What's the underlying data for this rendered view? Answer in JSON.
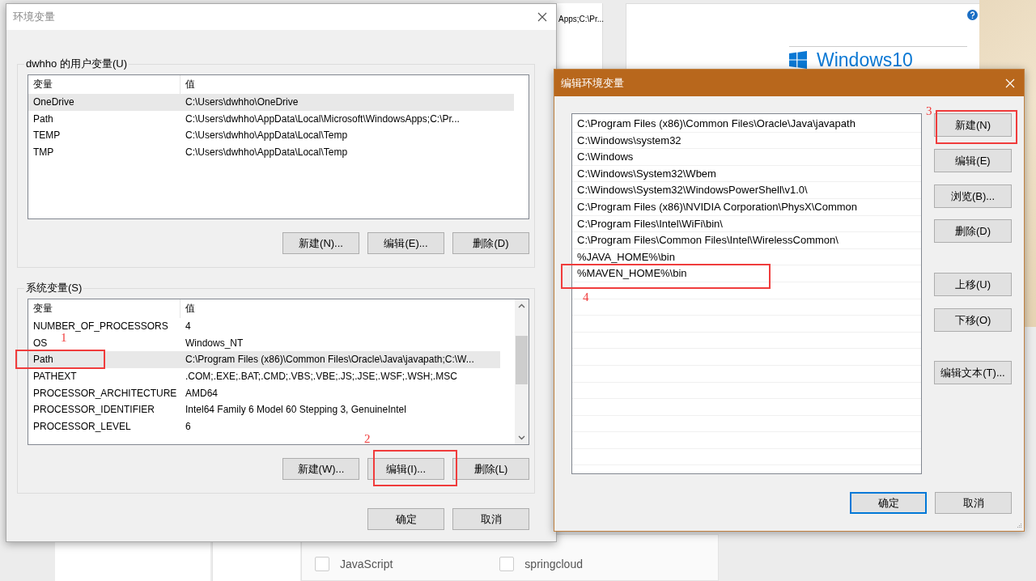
{
  "background": {
    "strip_text": "Apps;C:\\Pr...",
    "logo_text": "Windows10",
    "checkboxes": [
      {
        "label": "JavaScript",
        "checked": false
      },
      {
        "label": "springcloud",
        "checked": false
      }
    ]
  },
  "env_dialog": {
    "title": "环境变量",
    "user_group": {
      "label": "dwhho 的用户变量(U)",
      "columns": [
        "变量",
        "值"
      ],
      "rows": [
        {
          "name": "OneDrive",
          "value": "C:\\Users\\dwhho\\OneDrive",
          "selected": true
        },
        {
          "name": "Path",
          "value": "C:\\Users\\dwhho\\AppData\\Local\\Microsoft\\WindowsApps;C:\\Pr...",
          "selected": false
        },
        {
          "name": "TEMP",
          "value": "C:\\Users\\dwhho\\AppData\\Local\\Temp",
          "selected": false
        },
        {
          "name": "TMP",
          "value": "C:\\Users\\dwhho\\AppData\\Local\\Temp",
          "selected": false
        }
      ],
      "buttons": [
        "新建(N)...",
        "编辑(E)...",
        "删除(D)"
      ]
    },
    "system_group": {
      "label": "系统变量(S)",
      "columns": [
        "变量",
        "值"
      ],
      "rows": [
        {
          "name": "NUMBER_OF_PROCESSORS",
          "value": "4",
          "selected": false
        },
        {
          "name": "OS",
          "value": "Windows_NT",
          "selected": false
        },
        {
          "name": "Path",
          "value": "C:\\Program Files (x86)\\Common Files\\Oracle\\Java\\javapath;C:\\W...",
          "selected": true
        },
        {
          "name": "PATHEXT",
          "value": ".COM;.EXE;.BAT;.CMD;.VBS;.VBE;.JS;.JSE;.WSF;.WSH;.MSC",
          "selected": false
        },
        {
          "name": "PROCESSOR_ARCHITECTURE",
          "value": "AMD64",
          "selected": false
        },
        {
          "name": "PROCESSOR_IDENTIFIER",
          "value": "Intel64 Family 6 Model 60 Stepping 3, GenuineIntel",
          "selected": false
        },
        {
          "name": "PROCESSOR_LEVEL",
          "value": "6",
          "selected": false
        }
      ],
      "buttons": [
        "新建(W)...",
        "编辑(I)...",
        "删除(L)"
      ]
    },
    "buttons": [
      {
        "label": "确定",
        "default": false
      },
      {
        "label": "取消",
        "default": false
      }
    ]
  },
  "edit_dialog": {
    "title": "编辑环境变量",
    "entries": [
      {
        "text": "C:\\Program Files (x86)\\Common Files\\Oracle\\Java\\javapath",
        "selected": false
      },
      {
        "text": "C:\\Windows\\system32",
        "selected": false
      },
      {
        "text": "C:\\Windows",
        "selected": false
      },
      {
        "text": "C:\\Windows\\System32\\Wbem",
        "selected": false
      },
      {
        "text": "C:\\Windows\\System32\\WindowsPowerShell\\v1.0\\",
        "selected": false
      },
      {
        "text": "C:\\Program Files (x86)\\NVIDIA Corporation\\PhysX\\Common",
        "selected": false
      },
      {
        "text": "C:\\Program Files\\Intel\\WiFi\\bin\\",
        "selected": false
      },
      {
        "text": "C:\\Program Files\\Common Files\\Intel\\WirelessCommon\\",
        "selected": false
      },
      {
        "text": "%JAVA_HOME%\\bin",
        "selected": false
      },
      {
        "text": "%MAVEN_HOME%\\bin",
        "selected": false
      }
    ],
    "side_buttons": [
      "新建(N)",
      "编辑(E)",
      "浏览(B)...",
      "删除(D)",
      "上移(U)",
      "下移(O)",
      "编辑文本(T)..."
    ],
    "buttons": [
      {
        "label": "确定",
        "default": true
      },
      {
        "label": "取消",
        "default": false
      }
    ]
  },
  "annotations": [
    {
      "number": "1"
    },
    {
      "number": "2"
    },
    {
      "number": "3"
    },
    {
      "number": "4"
    }
  ]
}
